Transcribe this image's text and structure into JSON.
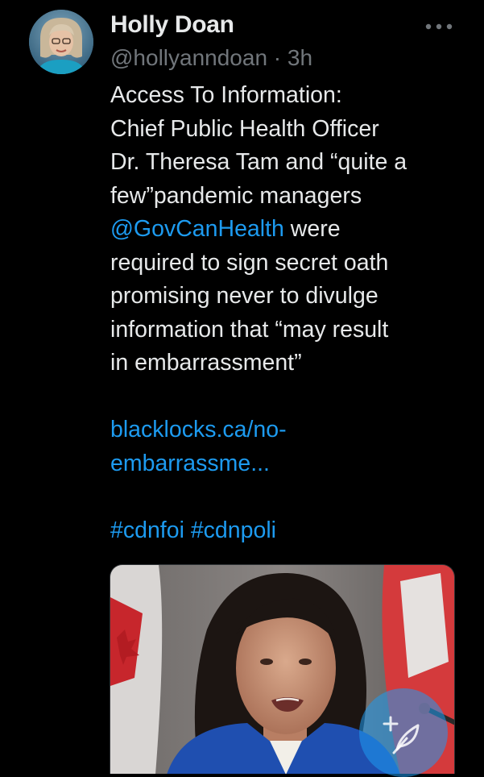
{
  "tweet": {
    "author_name": "Holly Doan",
    "handle": "@hollyanndoan",
    "separator": " · ",
    "time": "3h",
    "body": {
      "line1": "Access To Information:",
      "line2": "Chief Public Health Officer",
      "line3": "Dr. Theresa Tam and “quite a",
      "line4": "few”pandemic managers",
      "mention": "@GovCanHealth",
      "line5_rest": " were",
      "line6": "required to sign secret oath",
      "line7": "promising never to divulge",
      "line8": "information that “may result",
      "line9": "in embarrassment”",
      "url_line1": "blacklocks.ca/no-",
      "url_line2": "embarrassme...",
      "hashtag1": "#cdnfoi",
      "hashtag2": "#cdnpoli"
    }
  },
  "icons": {
    "more": "more-horizontal-icon",
    "compose": "compose-tweet-icon"
  },
  "colors": {
    "background": "#000000",
    "text": "#e7e9ea",
    "secondary": "#71767b",
    "accent": "#1d9bf0"
  }
}
